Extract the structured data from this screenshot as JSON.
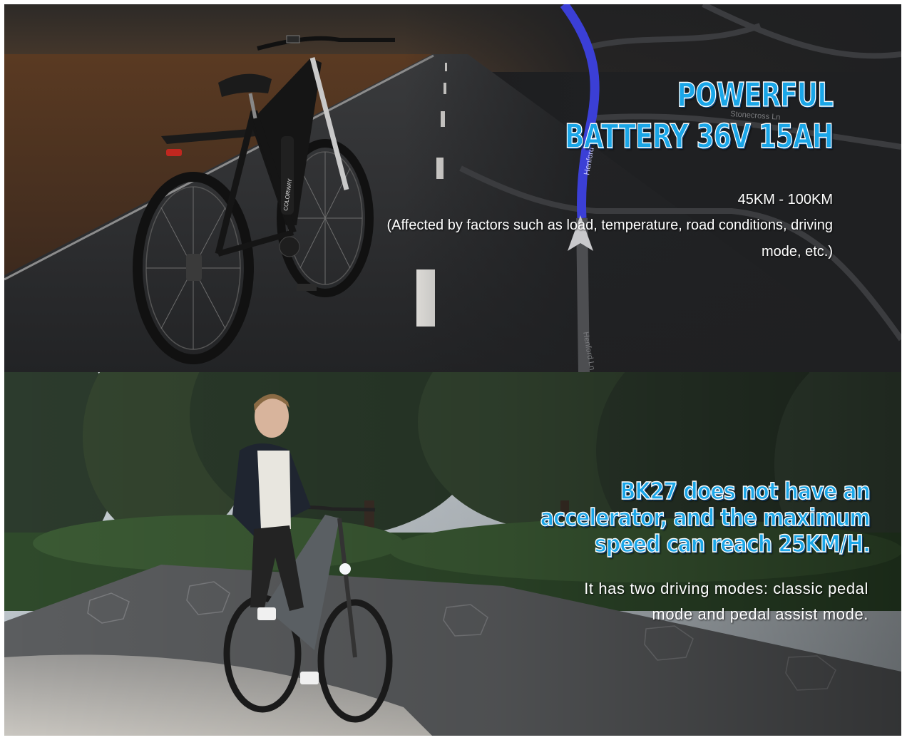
{
  "battery": {
    "headline_line1": "POWERFUL",
    "headline_line2": "BATTERY 36V 15AH",
    "range": "45KM - 100KM",
    "note": "(Affected by factors such as load, temperature, road conditions, driving mode, etc.)",
    "map_labels": {
      "street_top": "Stonecross Ln",
      "street_side": "Henford Ln",
      "street_bottom": "Henford Ln"
    },
    "bike_brand": "COLORWAY",
    "accent_color": "#1aa6e8",
    "route_color": "#3b3fd6"
  },
  "speed": {
    "headline": "BK27 does not have an accelerator, and the maximum speed can reach 25KM/H.",
    "modes": "It has two driving modes: classic pedal mode and pedal assist mode."
  }
}
